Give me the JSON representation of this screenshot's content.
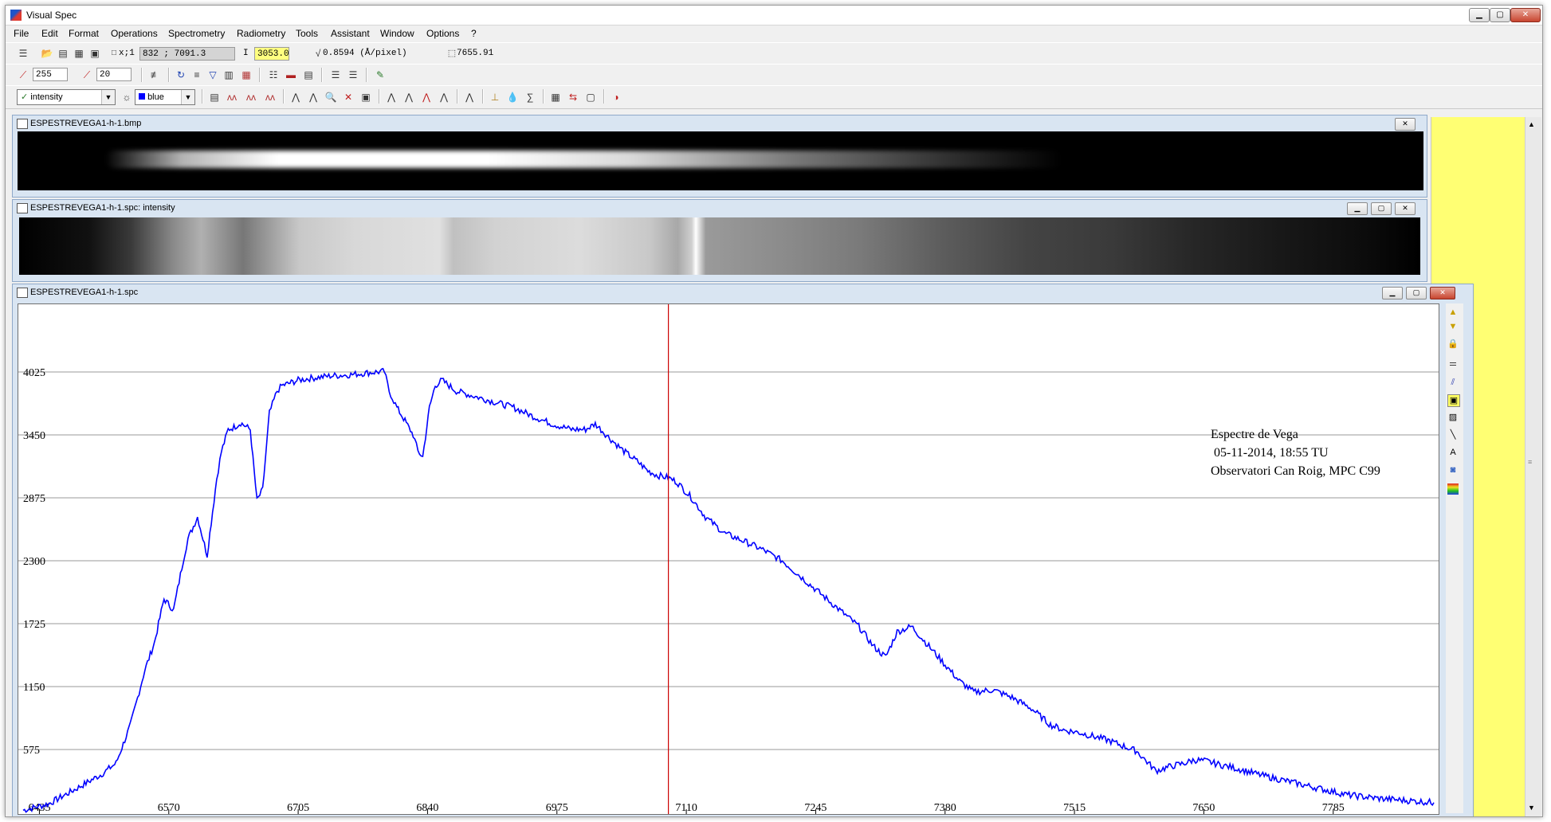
{
  "app": {
    "title": "Visual Spec",
    "window_buttons": {
      "minimize": "▁",
      "maximize": "▢",
      "close": "✕"
    }
  },
  "menu": [
    "File",
    "Edit",
    "Format",
    "Operations",
    "Spectrometry",
    "Radiometry",
    "Tools",
    "Assistant",
    "Window",
    "Options",
    "?"
  ],
  "toolbar1": {
    "zoom_label": "x;1",
    "coords": "832 ; 7091.3",
    "intensity_label": "I",
    "intensity_value": "3053.0",
    "dispersion": "0.8594 (Å/pixel)",
    "wavelength": "7655.91"
  },
  "toolbar2": {
    "field1": "255",
    "field2": "20"
  },
  "toolbar3": {
    "profile_select": "intensity",
    "color_select": "blue"
  },
  "windows": {
    "image": {
      "title": "ESPESTREVEGA1-h-1.bmp"
    },
    "spectrum_strip": {
      "title": "ESPESTREVEGA1-h-1.spc: intensity"
    },
    "graph": {
      "title": "ESPESTREVEGA1-h-1.spc"
    }
  },
  "colors": {
    "curve": "#0000ff",
    "cursor": "#cc0000",
    "side_pane": "#ffff73"
  },
  "chart_data": {
    "type": "line",
    "xlim": [
      6418,
      7890
    ],
    "ylim": [
      0,
      4600
    ],
    "x_ticks": [
      6435,
      6570,
      6705,
      6840,
      6975,
      7110,
      7245,
      7380,
      7515,
      7650,
      7785
    ],
    "x_tick_labels": [
      "6435",
      "6570",
      "6705",
      "6840",
      "6975",
      "7110",
      "7245",
      "7380",
      "7515",
      "7650",
      "7785"
    ],
    "y_ticks": [
      575,
      1150,
      1725,
      2300,
      2875,
      3450,
      4025
    ],
    "y_tick_labels": [
      "575",
      "1150",
      "1725",
      "2300",
      "2875",
      "3450",
      "4025"
    ],
    "grid": "horizontal",
    "cursor_x": 7091.3,
    "annotation": [
      "Espectre de Vega",
      " 05-11-2014, 18:55 TU",
      "Observatori Can Roig, MPC C99"
    ],
    "series": [
      {
        "x": [
          6418,
          6445,
          6470,
          6500,
          6515,
          6530,
          6545,
          6555,
          6565,
          6575,
          6585,
          6590,
          6600,
          6610,
          6620,
          6625,
          6632,
          6638,
          6645,
          6655,
          6662,
          6668,
          6675,
          6683,
          6688,
          6695,
          6705,
          6720,
          6740,
          6760,
          6780,
          6795,
          6800,
          6808,
          6815,
          6825,
          6830,
          6835,
          6842,
          6848,
          6855,
          6870,
          6890,
          6910,
          6930,
          6950,
          6970,
          6990,
          7005,
          7015,
          7030,
          7045,
          7060,
          7070,
          7080,
          7091,
          7100,
          7115,
          7130,
          7150,
          7170,
          7190,
          7210,
          7230,
          7250,
          7270,
          7290,
          7305,
          7318,
          7330,
          7345,
          7360,
          7380,
          7395,
          7410,
          7430,
          7450,
          7470,
          7490,
          7505,
          7520,
          7550,
          7580,
          7600,
          7615,
          7630,
          7640,
          7652,
          7665,
          7685,
          7710,
          7740,
          7770,
          7800,
          7830,
          7860,
          7890
        ],
        "y": [
          20,
          80,
          200,
          350,
          450,
          800,
          1300,
          1550,
          1950,
          1850,
          2300,
          2500,
          2700,
          2350,
          3050,
          3300,
          3500,
          3520,
          3560,
          3500,
          2850,
          2950,
          3650,
          3850,
          3900,
          3920,
          3950,
          3970,
          3990,
          4000,
          4020,
          4030,
          3850,
          3700,
          3600,
          3450,
          3300,
          3250,
          3700,
          3900,
          3950,
          3850,
          3800,
          3750,
          3700,
          3620,
          3550,
          3500,
          3500,
          3550,
          3420,
          3300,
          3200,
          3120,
          3080,
          3060,
          3020,
          2880,
          2700,
          2550,
          2480,
          2400,
          2300,
          2150,
          2000,
          1850,
          1700,
          1520,
          1420,
          1650,
          1700,
          1550,
          1350,
          1200,
          1100,
          1120,
          1050,
          950,
          800,
          750,
          730,
          660,
          560,
          380,
          420,
          450,
          480,
          470,
          440,
          400,
          340,
          280,
          220,
          160,
          130,
          110,
          90
        ]
      }
    ]
  }
}
